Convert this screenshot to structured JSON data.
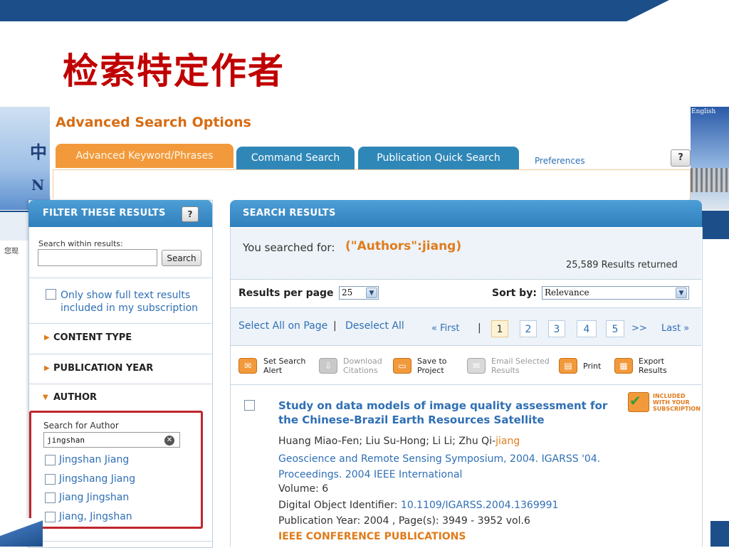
{
  "slide": {
    "title": "检索特定作者"
  },
  "background_site": {
    "english_link": "English",
    "left_chars": [
      "中",
      "N"
    ],
    "left_text": "您现"
  },
  "advanced_search": {
    "title": "Advanced Search Options",
    "tabs": [
      {
        "label": "Advanced Keyword/Phrases",
        "active": true
      },
      {
        "label": "Command Search",
        "active": false
      },
      {
        "label": "Publication Quick Search",
        "active": false
      }
    ],
    "preferences": "Preferences",
    "help": "?"
  },
  "filter": {
    "title": "FILTER THESE RESULTS",
    "help": "?",
    "search_within_label": "Search within results:",
    "search_within_value": "",
    "search_button": "Search",
    "fulltext_label": "Only show full text results included in my subscription",
    "facets": [
      "CONTENT TYPE",
      "PUBLICATION YEAR",
      "AUTHOR"
    ],
    "author": {
      "search_label": "Search for Author",
      "search_value": "jingshan",
      "options": [
        "Jingshan Jiang",
        "Jingshang Jiang",
        "Jiang Jingshan",
        "Jiang, Jingshan"
      ]
    }
  },
  "results": {
    "title": "SEARCH RESULTS",
    "searched_label": "You searched for:",
    "query": "(\"Authors\":jiang)",
    "count_text": "25,589 Results returned",
    "rpp_label": "Results per page",
    "rpp_value": "25",
    "sort_label": "Sort by:",
    "sort_value": "Relevance",
    "select_all": "Select All on Page",
    "deselect_all": "Deselect All",
    "pager": {
      "first": "« First",
      "pages": [
        "1",
        "2",
        "3",
        "4",
        "5"
      ],
      "current": "1",
      "next": ">>",
      "last": "Last »"
    },
    "tools": [
      {
        "label": "Set Search Alert",
        "enabled": true
      },
      {
        "label": "Download Citations",
        "enabled": false
      },
      {
        "label": "Save to Project",
        "enabled": true
      },
      {
        "label": "Email Selected Results",
        "enabled": false
      },
      {
        "label": "Print",
        "enabled": true
      },
      {
        "label": "Export Results",
        "enabled": true
      }
    ],
    "items": [
      {
        "title": "Study on data models of image quality assessment for the Chinese-Brazil Earth Resources Satellite",
        "authors": "Huang Miao-Fen; Liu Su-Hong; Li Li; Zhu Qi-",
        "authors_highlight": "jiang",
        "venue": "Geoscience and Remote Sensing Symposium, 2004. IGARSS '04. Proceedings. 2004 IEEE International",
        "volume": "Volume: 6",
        "doi_label": "Digital Object Identifier:",
        "doi": "10.1109/IGARSS.2004.1369991",
        "pub_info": "Publication Year: 2004 , Page(s): 3949 - 3952 vol.6",
        "type": "IEEE CONFERENCE PUBLICATIONS",
        "badge": "INCLUDED WITH YOUR SUBSCRIPTION"
      }
    ]
  },
  "colors": {
    "accent_orange": "#e07b1b",
    "link_blue": "#2f6fb5",
    "header_blue": "#2f7fbc",
    "highlight_red": "#c0262c",
    "title_red": "#c00000"
  }
}
